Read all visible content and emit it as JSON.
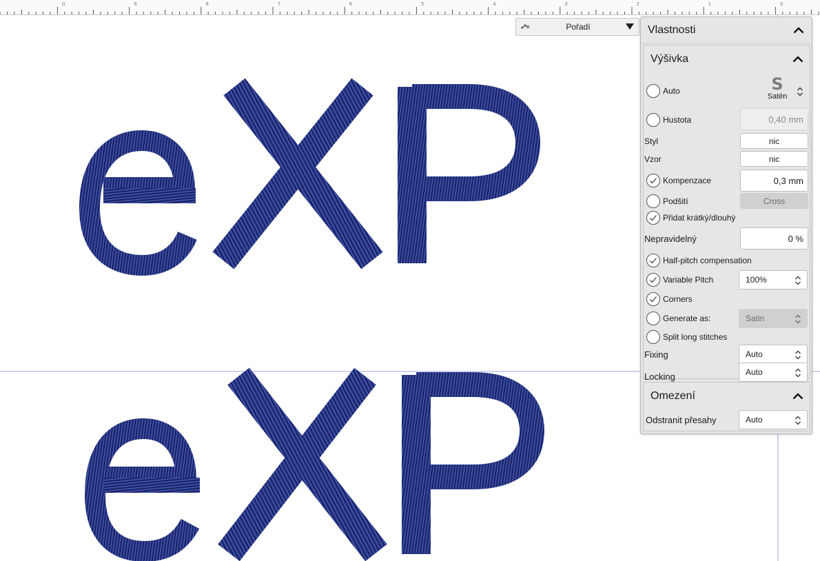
{
  "toolbar": {
    "order_label": "Pořadí",
    "order_icon": "stitch-order-icon",
    "dropdown_icon": "triangle-down-icon"
  },
  "ruler": {
    "labels": [
      "0",
      "9",
      "8",
      "7",
      "6",
      "5",
      "4",
      "3",
      "2",
      "1",
      "0"
    ]
  },
  "design": {
    "text": "eXP",
    "thread_color": "#1f2d7a"
  },
  "panel": {
    "title": "Vlastnosti",
    "embroidery": {
      "title": "Výšivka",
      "auto_label": "Auto",
      "stitch_type_glyph": "S",
      "stitch_type_label": "Satén",
      "density_label": "Hustota",
      "density_value": "0,40 mm",
      "style_label": "Styl",
      "style_value": "nic",
      "pattern_label": "Vzor",
      "pattern_value": "nic",
      "compensation_label": "Kompenzace",
      "compensation_value": "0,3 mm",
      "underlay_label": "Podšití",
      "underlay_value": "Cross",
      "short_long_label": "Přidat krátký/dlouhý",
      "irregular_label": "Nepravidelný",
      "irregular_value": "0 %",
      "half_pitch_label": "Half-pitch compensation",
      "variable_pitch_label": "Variable Pitch",
      "variable_pitch_value": "100%",
      "corners_label": "Corners",
      "generate_as_label": "Generate as:",
      "generate_as_value": "Satin",
      "split_label": "Split long stitches",
      "fixing_label": "Fixing",
      "fixing_value": "Auto",
      "locking_label": "Locking",
      "locking_value": "Auto",
      "checked": {
        "auto": false,
        "density": false,
        "compensation": true,
        "underlay": false,
        "short_long": true,
        "half_pitch": true,
        "variable_pitch": true,
        "corners": true,
        "generate_as": false,
        "split": false
      }
    },
    "limits": {
      "title": "Omezení",
      "remove_overlaps_label": "Odstranit přesahy",
      "remove_overlaps_value": "Auto"
    }
  }
}
